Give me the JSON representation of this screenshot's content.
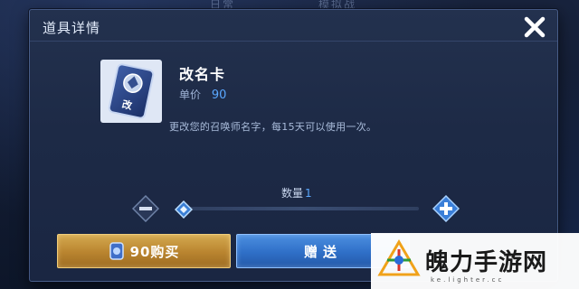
{
  "background_tabs": [
    "日常",
    "模拟战"
  ],
  "dialog": {
    "title": "道具详情",
    "close_icon": "close-icon"
  },
  "item": {
    "card_glyph": "改",
    "name": "改名卡",
    "price_label": "单价",
    "price_value": "90",
    "description": "更改您的召唤师名字，每15天可以使用一次。"
  },
  "quantity": {
    "label": "数量",
    "value": "1",
    "slider_fraction": 0.0,
    "minus_icon": "minus-icon",
    "plus_icon": "plus-icon"
  },
  "actions": {
    "buy_label": "90购买",
    "buy_icon": "coupon-icon",
    "gift_label": "赠送"
  },
  "watermark": {
    "text": "魄力手游网",
    "sub": "ke.lighter.cc"
  },
  "colors": {
    "accent_blue": "#5aa8ff",
    "buy_gold": "#c79a3f",
    "gift_blue": "#2f6fc7",
    "dialog_bg": "#1f2c49"
  }
}
